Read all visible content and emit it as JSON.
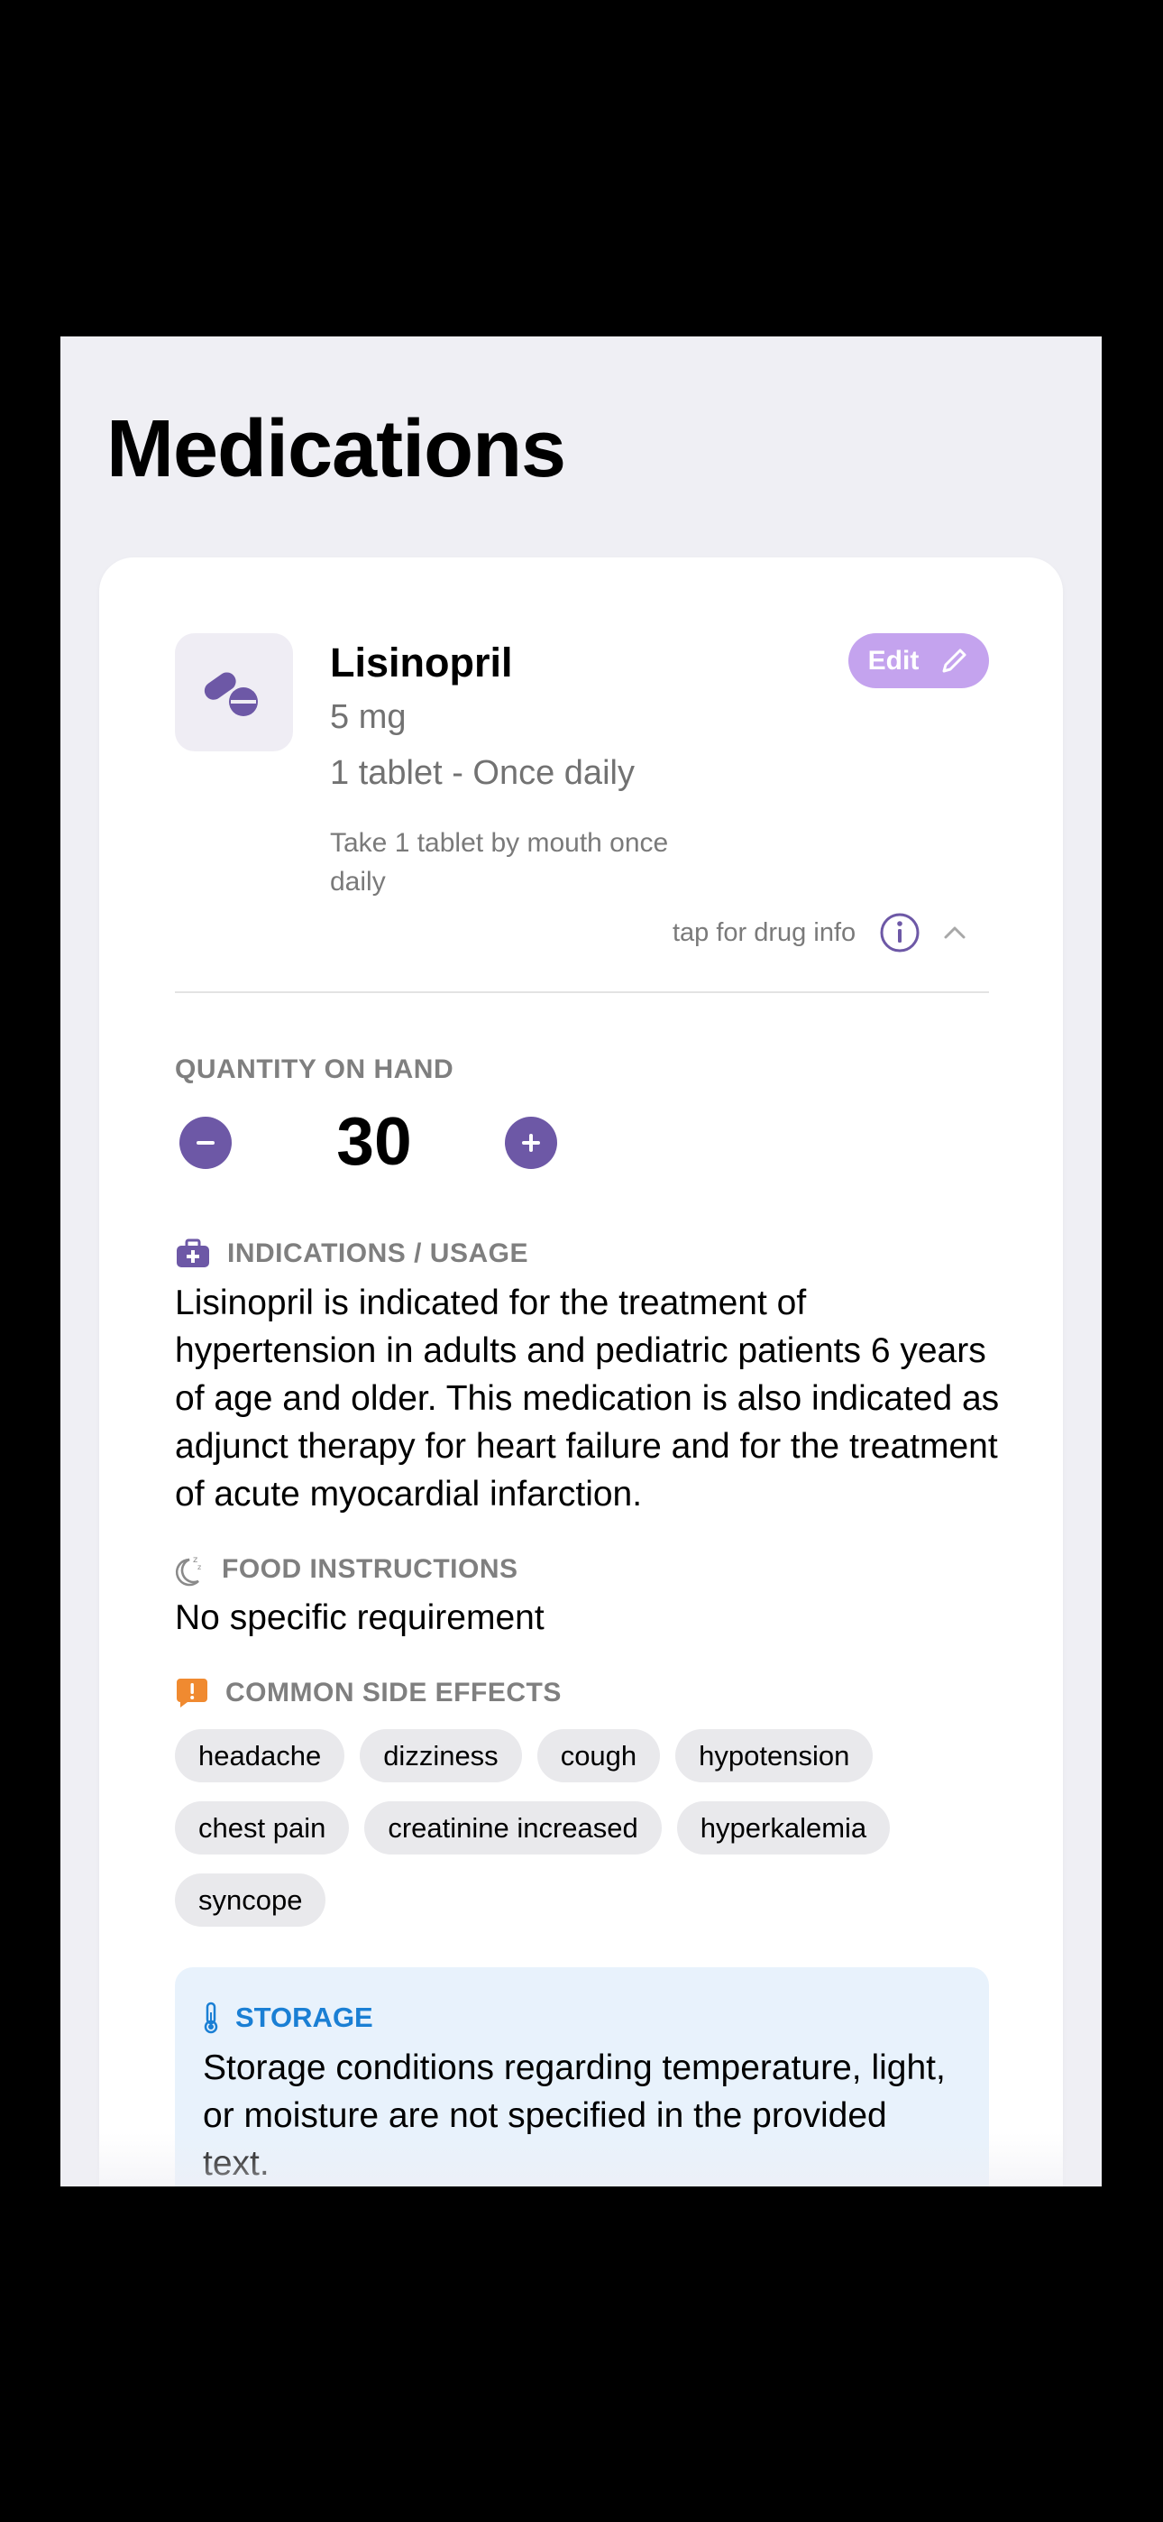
{
  "page": {
    "title": "Medications"
  },
  "medication": {
    "name": "Lisinopril",
    "dose": "5 mg",
    "frequency": "1 tablet - Once daily",
    "instructions": "Take 1 tablet by mouth once daily",
    "edit_label": "Edit",
    "drug_info_label": "tap for drug info"
  },
  "quantity": {
    "label": "QUANTITY ON HAND",
    "value": "30"
  },
  "indications": {
    "label": "INDICATIONS / USAGE",
    "text": "Lisinopril is indicated for the treatment of hypertension in adults and pediatric patients 6 years of age and older. This medication is also indicated as adjunct therapy for heart failure and for the treatment of acute myocardial infarction."
  },
  "food": {
    "label": "FOOD INSTRUCTIONS",
    "text": "No specific requirement"
  },
  "side_effects": {
    "label": "COMMON SIDE EFFECTS",
    "items": [
      "headache",
      "dizziness",
      "cough",
      "hypotension",
      "chest pain",
      "creatinine increased",
      "hyperkalemia",
      "syncope"
    ]
  },
  "storage": {
    "label": "STORAGE",
    "text": "Storage conditions regarding temperature, light, or moisture are not specified in the provided text."
  },
  "icons": {
    "pill": "pills-icon",
    "edit": "pencil-icon",
    "info": "info-circle-icon",
    "collapse": "chevron-up-icon",
    "indications": "medical-kit-icon",
    "food": "moon-zzz-icon",
    "side_effects": "alert-bubble-icon",
    "storage": "thermometer-icon"
  },
  "colors": {
    "accent": "#6d58a6",
    "edit_button": "#c4a3ee",
    "side_effects_icon": "#f08a30",
    "storage_accent": "#1a7fd4",
    "storage_bg": "#e8f2fc"
  }
}
